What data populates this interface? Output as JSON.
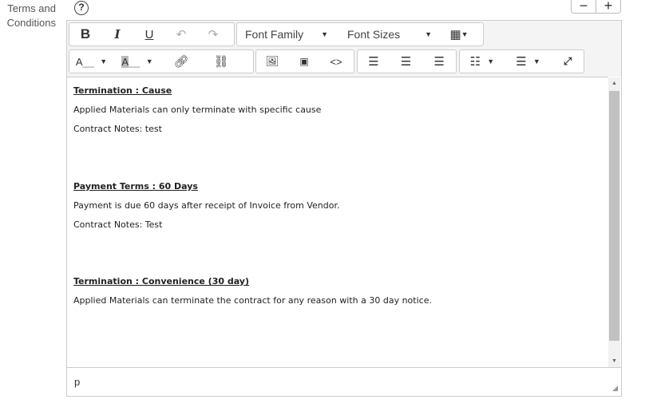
{
  "field": {
    "label_line1": "Terms and",
    "label_line2": "Conditions",
    "help": "?"
  },
  "zoom_controls": {
    "minus": "−",
    "plus": "+"
  },
  "toolbar": {
    "bold": "B",
    "italic": "I",
    "underline": "U",
    "font_family": "Font Family",
    "font_sizes": "Font Sizes",
    "text_color": "A",
    "bg_color": "A"
  },
  "content": {
    "sections": [
      {
        "heading": "Termination : Cause",
        "lines": [
          "Applied Materials can only terminate with specific cause",
          "Contract Notes: test"
        ]
      },
      {
        "heading": "Payment Terms : 60 Days",
        "lines": [
          "Payment is due 60 days after receipt of Invoice from Vendor.",
          "Contract Notes: Test"
        ]
      },
      {
        "heading": "Termination : Convenience (30 day)",
        "lines": [
          "Applied Materials can terminate the contract for any reason with a 30 day notice."
        ]
      }
    ]
  },
  "status": {
    "path": "p"
  }
}
